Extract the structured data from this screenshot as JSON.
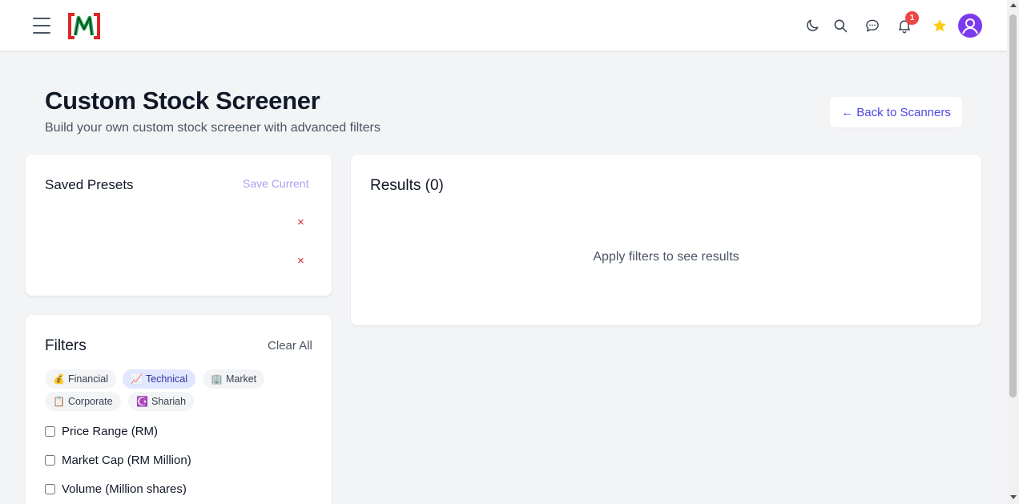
{
  "header": {
    "logo_alt": "M",
    "notification_count": "1",
    "icons": [
      "menu-icon",
      "moon-icon",
      "search-icon",
      "chat-icon",
      "bell-icon",
      "star-icon",
      "avatar"
    ]
  },
  "page": {
    "title": "Custom Stock Screener",
    "subtitle": "Build your own custom stock screener with advanced filters",
    "back_label": "← Back to Scanners"
  },
  "presets": {
    "title": "Saved Presets",
    "save_label": "Save Current",
    "delete_symbol": "×"
  },
  "results": {
    "title": "Results (0)",
    "empty_message": "Apply filters to see results"
  },
  "filters": {
    "title": "Filters",
    "clear_label": "Clear All",
    "categories": [
      {
        "icon": "💰",
        "label": "Financial"
      },
      {
        "icon": "📈",
        "label": "Technical"
      },
      {
        "icon": "🏢",
        "label": "Market"
      },
      {
        "icon": "📋",
        "label": "Corporate"
      },
      {
        "icon": "☪️",
        "label": "Shariah"
      }
    ],
    "active_category": "Technical",
    "options": [
      {
        "label": "Price Range (RM)"
      },
      {
        "label": "Market Cap (RM Million)"
      },
      {
        "label": "Volume (Million shares)"
      }
    ]
  },
  "colors": {
    "accent": "#4f46e5",
    "danger": "#dc2626",
    "star": "#facc15",
    "avatar": "#7c3aed"
  }
}
